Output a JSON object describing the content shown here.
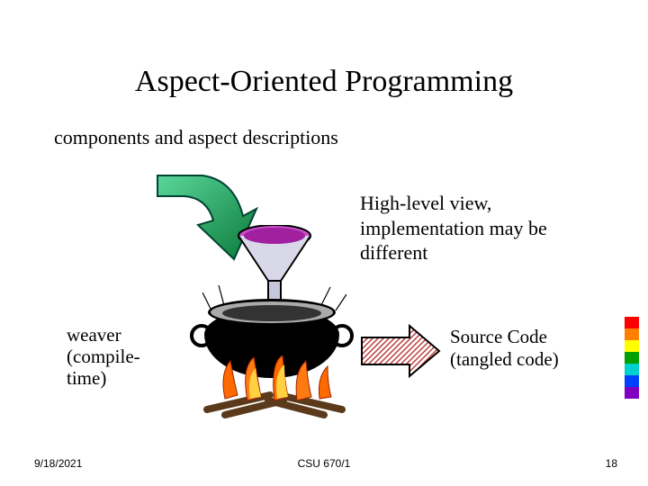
{
  "title": "Aspect-Oriented Programming",
  "subtitle": "components and aspect descriptions",
  "high_level_view": "High-level view, implementation may be different",
  "weaver_label": "weaver (compile-time)",
  "source_code_label": "Source Code (tangled code)",
  "footer": {
    "date": "9/18/2021",
    "center": "CSU 670/1",
    "page": "18"
  },
  "icons": {
    "green_arrow": "down-right-arrow-icon",
    "funnel": "funnel-icon",
    "cauldron": "cauldron-icon",
    "fire": "fire-icon",
    "hatched_arrow": "right-arrow-hatched-icon"
  },
  "color_bar": [
    "#ff0000",
    "#ff8000",
    "#ffff00",
    "#00a000",
    "#00d0d0",
    "#0040ff",
    "#8000c0"
  ]
}
